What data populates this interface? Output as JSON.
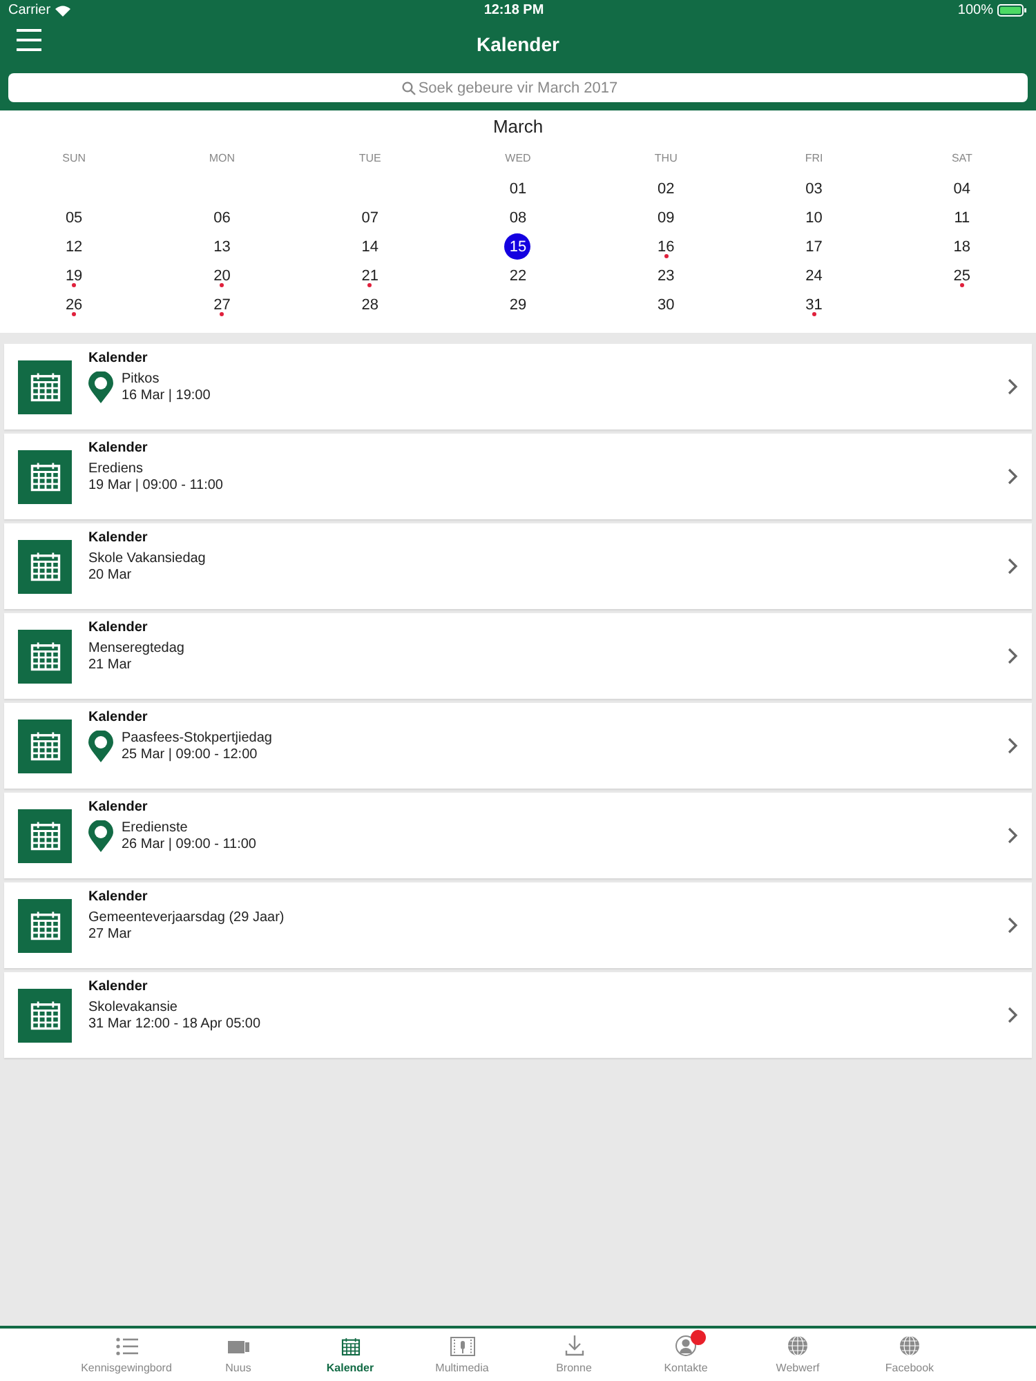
{
  "status_bar": {
    "carrier": "Carrier",
    "time": "12:18 PM",
    "battery": "100%"
  },
  "header": {
    "title": "Kalender"
  },
  "search": {
    "placeholder": "Soek gebeure vir March 2017"
  },
  "calendar": {
    "month": "March",
    "weekdays": [
      "SUN",
      "MON",
      "TUE",
      "WED",
      "THU",
      "FRI",
      "SAT"
    ],
    "weeks": [
      [
        {
          "day": "01",
          "event": false,
          "selected": false
        },
        {
          "day": "02",
          "event": false,
          "selected": false
        },
        {
          "day": "03",
          "event": false,
          "selected": false
        },
        {
          "day": "04",
          "event": false,
          "selected": false
        }
      ],
      [
        {
          "day": "05",
          "event": false,
          "selected": false
        },
        {
          "day": "06",
          "event": false,
          "selected": false
        },
        {
          "day": "07",
          "event": false,
          "selected": false
        },
        {
          "day": "08",
          "event": false,
          "selected": false
        },
        {
          "day": "09",
          "event": false,
          "selected": false
        },
        {
          "day": "10",
          "event": false,
          "selected": false
        },
        {
          "day": "11",
          "event": false,
          "selected": false
        }
      ],
      [
        {
          "day": "12",
          "event": false,
          "selected": false
        },
        {
          "day": "13",
          "event": false,
          "selected": false
        },
        {
          "day": "14",
          "event": false,
          "selected": false
        },
        {
          "day": "15",
          "event": false,
          "selected": true
        },
        {
          "day": "16",
          "event": true,
          "selected": false
        },
        {
          "day": "17",
          "event": false,
          "selected": false
        },
        {
          "day": "18",
          "event": false,
          "selected": false
        }
      ],
      [
        {
          "day": "19",
          "event": true,
          "selected": false
        },
        {
          "day": "20",
          "event": true,
          "selected": false
        },
        {
          "day": "21",
          "event": true,
          "selected": false
        },
        {
          "day": "22",
          "event": false,
          "selected": false
        },
        {
          "day": "23",
          "event": false,
          "selected": false
        },
        {
          "day": "24",
          "event": false,
          "selected": false
        },
        {
          "day": "25",
          "event": true,
          "selected": false
        }
      ],
      [
        {
          "day": "26",
          "event": true,
          "selected": false
        },
        {
          "day": "27",
          "event": true,
          "selected": false
        },
        {
          "day": "28",
          "event": false,
          "selected": false
        },
        {
          "day": "29",
          "event": false,
          "selected": false
        },
        {
          "day": "30",
          "event": false,
          "selected": false
        },
        {
          "day": "31",
          "event": true,
          "selected": false
        }
      ]
    ]
  },
  "events": [
    {
      "category": "Kalender",
      "title": "Pitkos",
      "when": "16 Mar | 19:00",
      "location": true
    },
    {
      "category": "Kalender",
      "title": "Erediens",
      "when": "19 Mar | 09:00 - 11:00",
      "location": false
    },
    {
      "category": "Kalender",
      "title": "Skole Vakansiedag",
      "when": "20 Mar",
      "location": false
    },
    {
      "category": "Kalender",
      "title": "Menseregtedag",
      "when": "21 Mar",
      "location": false
    },
    {
      "category": "Kalender",
      "title": "Paasfees-Stokpertjiedag",
      "when": "25 Mar | 09:00 - 12:00",
      "location": true
    },
    {
      "category": "Kalender",
      "title": "Eredienste",
      "when": "26 Mar | 09:00 - 11:00",
      "location": true
    },
    {
      "category": "Kalender",
      "title": "Gemeenteverjaarsdag (29 Jaar)",
      "when": "27 Mar",
      "location": false
    },
    {
      "category": "Kalender",
      "title": "Skolevakansie",
      "when": "31 Mar 12:00 - 18 Apr 05:00",
      "location": false
    }
  ],
  "tab_bar": [
    {
      "label": "Kennisgewingbord",
      "kind": "list",
      "selected": false,
      "badge": false
    },
    {
      "label": "Nuus",
      "kind": "news",
      "selected": false,
      "badge": false
    },
    {
      "label": "Kalender",
      "kind": "calendar",
      "selected": true,
      "badge": false
    },
    {
      "label": "Multimedia",
      "kind": "media",
      "selected": false,
      "badge": false
    },
    {
      "label": "Bronne",
      "kind": "download",
      "selected": false,
      "badge": false
    },
    {
      "label": "Kontakte",
      "kind": "person",
      "selected": false,
      "badge": true
    },
    {
      "label": "Webwerf",
      "kind": "globe",
      "selected": false,
      "badge": false
    },
    {
      "label": "Facebook",
      "kind": "globe",
      "selected": false,
      "badge": false
    }
  ]
}
